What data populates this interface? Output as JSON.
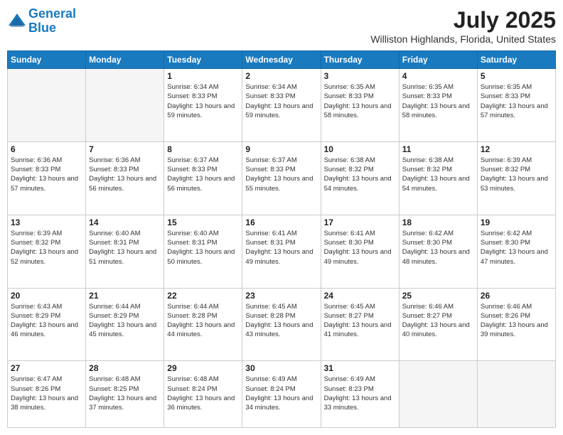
{
  "header": {
    "logo_line1": "General",
    "logo_line2": "Blue",
    "month_year": "July 2025",
    "location": "Williston Highlands, Florida, United States"
  },
  "days_of_week": [
    "Sunday",
    "Monday",
    "Tuesday",
    "Wednesday",
    "Thursday",
    "Friday",
    "Saturday"
  ],
  "weeks": [
    [
      {
        "day": "",
        "info": ""
      },
      {
        "day": "",
        "info": ""
      },
      {
        "day": "1",
        "info": "Sunrise: 6:34 AM\nSunset: 8:33 PM\nDaylight: 13 hours and 59 minutes."
      },
      {
        "day": "2",
        "info": "Sunrise: 6:34 AM\nSunset: 8:33 PM\nDaylight: 13 hours and 59 minutes."
      },
      {
        "day": "3",
        "info": "Sunrise: 6:35 AM\nSunset: 8:33 PM\nDaylight: 13 hours and 58 minutes."
      },
      {
        "day": "4",
        "info": "Sunrise: 6:35 AM\nSunset: 8:33 PM\nDaylight: 13 hours and 58 minutes."
      },
      {
        "day": "5",
        "info": "Sunrise: 6:35 AM\nSunset: 8:33 PM\nDaylight: 13 hours and 57 minutes."
      }
    ],
    [
      {
        "day": "6",
        "info": "Sunrise: 6:36 AM\nSunset: 8:33 PM\nDaylight: 13 hours and 57 minutes."
      },
      {
        "day": "7",
        "info": "Sunrise: 6:36 AM\nSunset: 8:33 PM\nDaylight: 13 hours and 56 minutes."
      },
      {
        "day": "8",
        "info": "Sunrise: 6:37 AM\nSunset: 8:33 PM\nDaylight: 13 hours and 56 minutes."
      },
      {
        "day": "9",
        "info": "Sunrise: 6:37 AM\nSunset: 8:33 PM\nDaylight: 13 hours and 55 minutes."
      },
      {
        "day": "10",
        "info": "Sunrise: 6:38 AM\nSunset: 8:32 PM\nDaylight: 13 hours and 54 minutes."
      },
      {
        "day": "11",
        "info": "Sunrise: 6:38 AM\nSunset: 8:32 PM\nDaylight: 13 hours and 54 minutes."
      },
      {
        "day": "12",
        "info": "Sunrise: 6:39 AM\nSunset: 8:32 PM\nDaylight: 13 hours and 53 minutes."
      }
    ],
    [
      {
        "day": "13",
        "info": "Sunrise: 6:39 AM\nSunset: 8:32 PM\nDaylight: 13 hours and 52 minutes."
      },
      {
        "day": "14",
        "info": "Sunrise: 6:40 AM\nSunset: 8:31 PM\nDaylight: 13 hours and 51 minutes."
      },
      {
        "day": "15",
        "info": "Sunrise: 6:40 AM\nSunset: 8:31 PM\nDaylight: 13 hours and 50 minutes."
      },
      {
        "day": "16",
        "info": "Sunrise: 6:41 AM\nSunset: 8:31 PM\nDaylight: 13 hours and 49 minutes."
      },
      {
        "day": "17",
        "info": "Sunrise: 6:41 AM\nSunset: 8:30 PM\nDaylight: 13 hours and 49 minutes."
      },
      {
        "day": "18",
        "info": "Sunrise: 6:42 AM\nSunset: 8:30 PM\nDaylight: 13 hours and 48 minutes."
      },
      {
        "day": "19",
        "info": "Sunrise: 6:42 AM\nSunset: 8:30 PM\nDaylight: 13 hours and 47 minutes."
      }
    ],
    [
      {
        "day": "20",
        "info": "Sunrise: 6:43 AM\nSunset: 8:29 PM\nDaylight: 13 hours and 46 minutes."
      },
      {
        "day": "21",
        "info": "Sunrise: 6:44 AM\nSunset: 8:29 PM\nDaylight: 13 hours and 45 minutes."
      },
      {
        "day": "22",
        "info": "Sunrise: 6:44 AM\nSunset: 8:28 PM\nDaylight: 13 hours and 44 minutes."
      },
      {
        "day": "23",
        "info": "Sunrise: 6:45 AM\nSunset: 8:28 PM\nDaylight: 13 hours and 43 minutes."
      },
      {
        "day": "24",
        "info": "Sunrise: 6:45 AM\nSunset: 8:27 PM\nDaylight: 13 hours and 41 minutes."
      },
      {
        "day": "25",
        "info": "Sunrise: 6:46 AM\nSunset: 8:27 PM\nDaylight: 13 hours and 40 minutes."
      },
      {
        "day": "26",
        "info": "Sunrise: 6:46 AM\nSunset: 8:26 PM\nDaylight: 13 hours and 39 minutes."
      }
    ],
    [
      {
        "day": "27",
        "info": "Sunrise: 6:47 AM\nSunset: 8:26 PM\nDaylight: 13 hours and 38 minutes."
      },
      {
        "day": "28",
        "info": "Sunrise: 6:48 AM\nSunset: 8:25 PM\nDaylight: 13 hours and 37 minutes."
      },
      {
        "day": "29",
        "info": "Sunrise: 6:48 AM\nSunset: 8:24 PM\nDaylight: 13 hours and 36 minutes."
      },
      {
        "day": "30",
        "info": "Sunrise: 6:49 AM\nSunset: 8:24 PM\nDaylight: 13 hours and 34 minutes."
      },
      {
        "day": "31",
        "info": "Sunrise: 6:49 AM\nSunset: 8:23 PM\nDaylight: 13 hours and 33 minutes."
      },
      {
        "day": "",
        "info": ""
      },
      {
        "day": "",
        "info": ""
      }
    ]
  ]
}
